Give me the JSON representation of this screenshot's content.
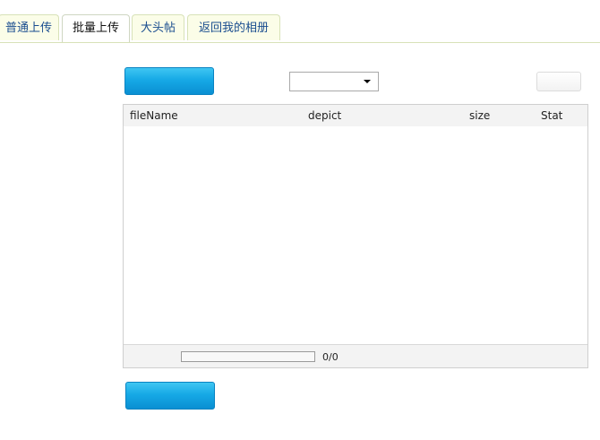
{
  "tabs": [
    {
      "label": "普通上传",
      "active": false
    },
    {
      "label": "批量上传",
      "active": true
    },
    {
      "label": "大头帖",
      "active": false
    },
    {
      "label": "返回我的相册",
      "active": false
    }
  ],
  "toolbar": {
    "select_value": "",
    "colors": {
      "button_blue": "#16a9e6",
      "tab_bg": "#fbfde8",
      "tab_text": "#1a4d8f"
    }
  },
  "filelist": {
    "columns": [
      "fileName",
      "depict",
      "size",
      "Stat"
    ],
    "rows": [],
    "progress": {
      "text": "0/0",
      "fraction": 0
    }
  }
}
